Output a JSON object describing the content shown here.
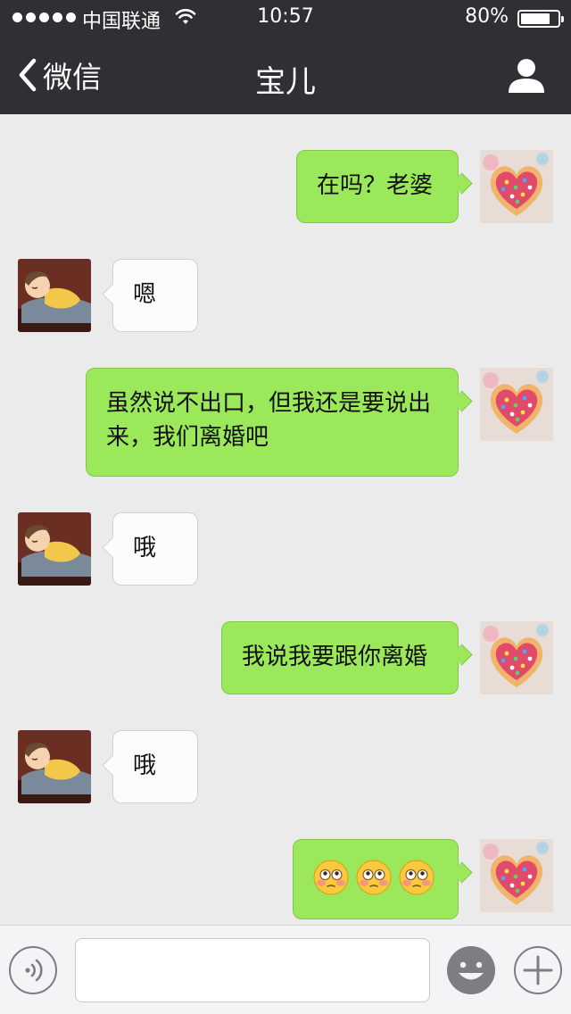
{
  "status_bar": {
    "carrier": "中国联通",
    "time": "10:57",
    "battery": "80%",
    "battery_level": 0.8
  },
  "nav": {
    "back_label": "微信",
    "title": "宝儿"
  },
  "messages": [
    {
      "side": "out",
      "text": "在吗？老婆"
    },
    {
      "side": "in",
      "text": "嗯"
    },
    {
      "side": "out",
      "text": "虽然说不出口，但我还是要说出来，我们离婚吧"
    },
    {
      "side": "in",
      "text": "哦"
    },
    {
      "side": "out",
      "text": "我说我要跟你离婚"
    },
    {
      "side": "in",
      "text": "哦"
    },
    {
      "side": "out",
      "emoji": [
        "flushed-face",
        "flushed-face",
        "flushed-face"
      ]
    }
  ],
  "colors": {
    "header_bg": "#2e3033",
    "chat_bg": "#ebebeb",
    "outgoing_bubble": "#9be85a",
    "incoming_bubble": "#fcfcfc"
  },
  "input": {
    "value": "",
    "placeholder": ""
  }
}
